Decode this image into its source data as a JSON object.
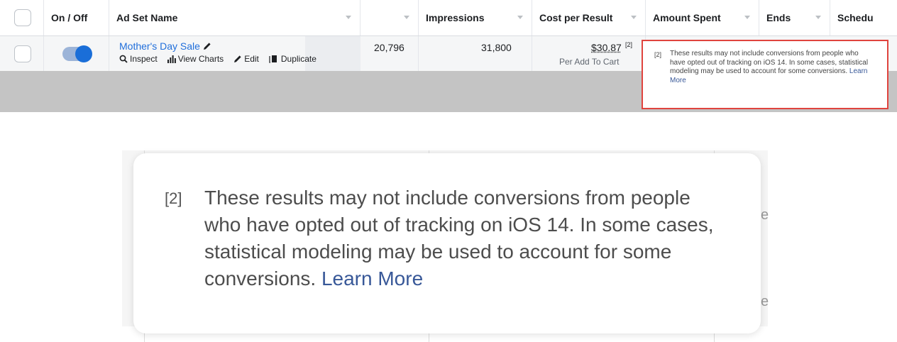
{
  "header": {
    "on_off": "On / Off",
    "ad_set_name": "Ad Set Name",
    "impressions": "Impressions",
    "cost_per_result": "Cost per Result",
    "amount_spent": "Amount Spent",
    "ends": "Ends",
    "schedule": "Schedu"
  },
  "row": {
    "name": "Mother's Day Sale",
    "actions": {
      "inspect": "Inspect",
      "view_charts": "View Charts",
      "edit": "Edit",
      "duplicate": "Duplicate"
    },
    "reach": "20,796",
    "impressions": "31,800",
    "cost_per_result": "$30.87",
    "footnote_ref": "[2]",
    "cost_subtitle": "Per Add To Cart",
    "toggle_on": true
  },
  "tooltip": {
    "number": "[2]",
    "text": "These results may not include conversions from people who have opted out of tracking on iOS 14. In some cases, statistical modeling may be used to account for some conversions.",
    "link": "Learn More"
  },
  "zoom": {
    "edge_char": "e"
  },
  "colors": {
    "link": "#216fdb",
    "toggle_knob": "#1a6ed8",
    "highlight_border": "#e0443e",
    "learn_more": "#385898"
  }
}
